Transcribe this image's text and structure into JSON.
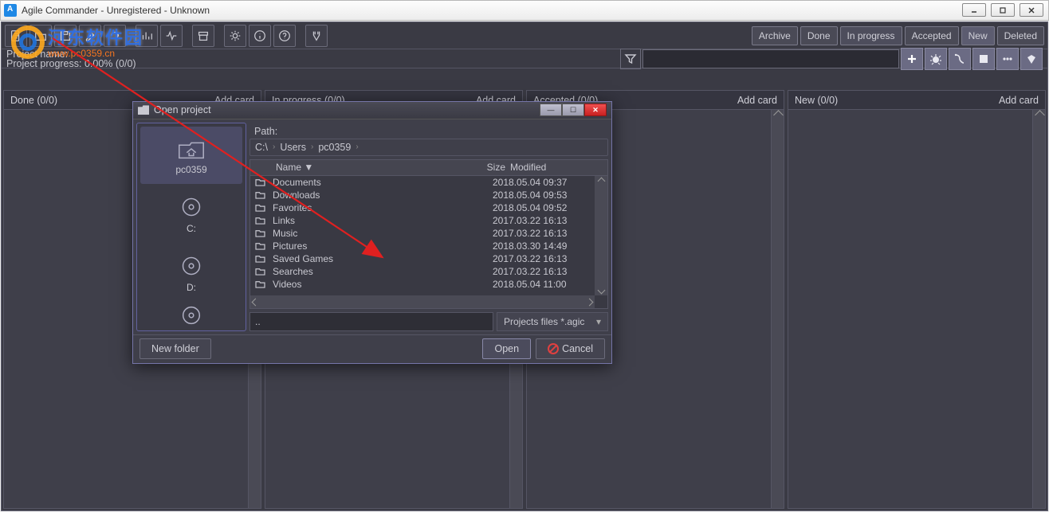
{
  "window": {
    "title": "Agile Commander - Unregistered - Unknown"
  },
  "overlay": {
    "txt": "河东软件园",
    "sub": "www.pc0359.cn"
  },
  "toolbar": {
    "icons": [
      "new-project",
      "open-project",
      "save-project",
      "undo",
      "redo",
      "card-view",
      "chart",
      "activity",
      "archive",
      "settings",
      "info",
      "help",
      "tools"
    ]
  },
  "status_buttons": [
    {
      "label": "Archive",
      "name": "archive"
    },
    {
      "label": "Done",
      "name": "done"
    },
    {
      "label": "In progress",
      "name": "in-progress"
    },
    {
      "label": "Accepted",
      "name": "accepted"
    },
    {
      "label": "New",
      "name": "new"
    },
    {
      "label": "Deleted",
      "name": "deleted"
    }
  ],
  "info": {
    "project_name_label": "Project name:",
    "project_progress_label": "Project progress: 0.00% (0/0)"
  },
  "card_tools": [
    "add",
    "bug",
    "tag",
    "note",
    "more",
    "gem"
  ],
  "columns": [
    {
      "title": "Done (0/0)",
      "add": "Add card"
    },
    {
      "title": "In progress (0/0)",
      "add": "Add card"
    },
    {
      "title": "Accepted (0/0)",
      "add": "Add card"
    },
    {
      "title": "New (0/0)",
      "add": "Add card"
    }
  ],
  "dialog": {
    "title": "Open project",
    "path_label": "Path:",
    "breadcrumb": [
      "C:\\",
      "Users",
      "pc0359"
    ],
    "places": [
      {
        "label": "pc0359",
        "icon": "home"
      },
      {
        "label": "C:",
        "icon": "disk"
      },
      {
        "label": "D:",
        "icon": "disk"
      },
      {
        "label": "",
        "icon": "disk"
      }
    ],
    "columns": {
      "name": "Name ▼",
      "size": "Size",
      "modified": "Modified"
    },
    "rows": [
      {
        "name": "Documents",
        "size": "",
        "modified": "2018.05.04 09:37"
      },
      {
        "name": "Downloads",
        "size": "",
        "modified": "2018.05.04 09:53"
      },
      {
        "name": "Favorites",
        "size": "",
        "modified": "2018.05.04 09:52"
      },
      {
        "name": "Links",
        "size": "",
        "modified": "2017.03.22 16:13"
      },
      {
        "name": "Music",
        "size": "",
        "modified": "2017.03.22 16:13"
      },
      {
        "name": "Pictures",
        "size": "",
        "modified": "2018.03.30 14:49"
      },
      {
        "name": "Saved Games",
        "size": "",
        "modified": "2017.03.22 16:13"
      },
      {
        "name": "Searches",
        "size": "",
        "modified": "2017.03.22 16:13"
      },
      {
        "name": "Videos",
        "size": "",
        "modified": "2018.05.04 11:00"
      }
    ],
    "filename": "..",
    "filetype": "Projects files *.agic",
    "new_folder": "New folder",
    "open": "Open",
    "cancel": "Cancel"
  }
}
